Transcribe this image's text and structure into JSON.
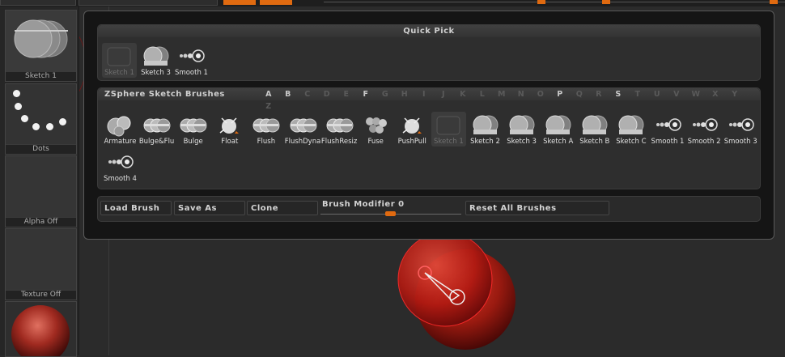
{
  "left_panel": {
    "brush_label": "Sketch 1",
    "stroke_label": "Dots",
    "alpha_label": "Alpha Off",
    "texture_label": "Texture Off"
  },
  "quick_pick": {
    "title": "Quick Pick",
    "items": [
      {
        "label": "Sketch 1",
        "selected": true
      },
      {
        "label": "Sketch 3"
      },
      {
        "label": "Smooth 1"
      }
    ]
  },
  "zsphere_brushes": {
    "title": "ZSphere Sketch Brushes",
    "letters": [
      "A",
      "B",
      "C",
      "D",
      "E",
      "F",
      "G",
      "H",
      "I",
      "J",
      "K",
      "L",
      "M",
      "N",
      "O",
      "P",
      "Q",
      "R",
      "S",
      "T",
      "U",
      "V",
      "W",
      "X",
      "Y",
      "Z"
    ],
    "active_letters": [
      "A",
      "B",
      "F",
      "P",
      "S"
    ],
    "items": [
      {
        "label": "Armature"
      },
      {
        "label": "Bulge&Flu"
      },
      {
        "label": "Bulge"
      },
      {
        "label": "Float"
      },
      {
        "label": "Flush"
      },
      {
        "label": "FlushDyna"
      },
      {
        "label": "FlushResiz"
      },
      {
        "label": "Fuse"
      },
      {
        "label": "PushPull"
      },
      {
        "label": "Sketch 1",
        "selected": true
      },
      {
        "label": "Sketch 2"
      },
      {
        "label": "Sketch 3"
      },
      {
        "label": "Sketch A"
      },
      {
        "label": "Sketch B"
      },
      {
        "label": "Sketch C"
      },
      {
        "label": "Smooth 1"
      },
      {
        "label": "Smooth 2"
      },
      {
        "label": "Smooth 3"
      },
      {
        "label": "Smooth 4"
      }
    ]
  },
  "actions": {
    "load_brush": "Load Brush",
    "save_as": "Save As",
    "clone": "Clone",
    "brush_modifier_label": "Brush Modifier",
    "brush_modifier_value": "0",
    "reset_all": "Reset All Brushes"
  },
  "colors": {
    "accent": "#e06a10",
    "sphere_red": "#b01010",
    "panel_bg": "#2e2e2e"
  }
}
